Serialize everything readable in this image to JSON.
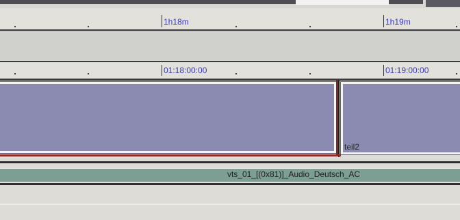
{
  "ruler_top": {
    "labels": [
      "1h18m",
      "1h19m"
    ]
  },
  "ruler_bottom": {
    "labels": [
      "01:18:00:00",
      "01:19:00:00"
    ]
  },
  "video_track": {
    "clips": [
      {
        "label": ""
      },
      {
        "label": "teil2"
      }
    ],
    "clip_color": "#8b8ab1"
  },
  "audio_track": {
    "label": "vts_01_[(0x81)]_Audio_Deutsch_AC",
    "color": "#7d9e93"
  },
  "colors": {
    "ruler_label": "#3b3bb5",
    "red_marker": "#8e2a2a"
  }
}
